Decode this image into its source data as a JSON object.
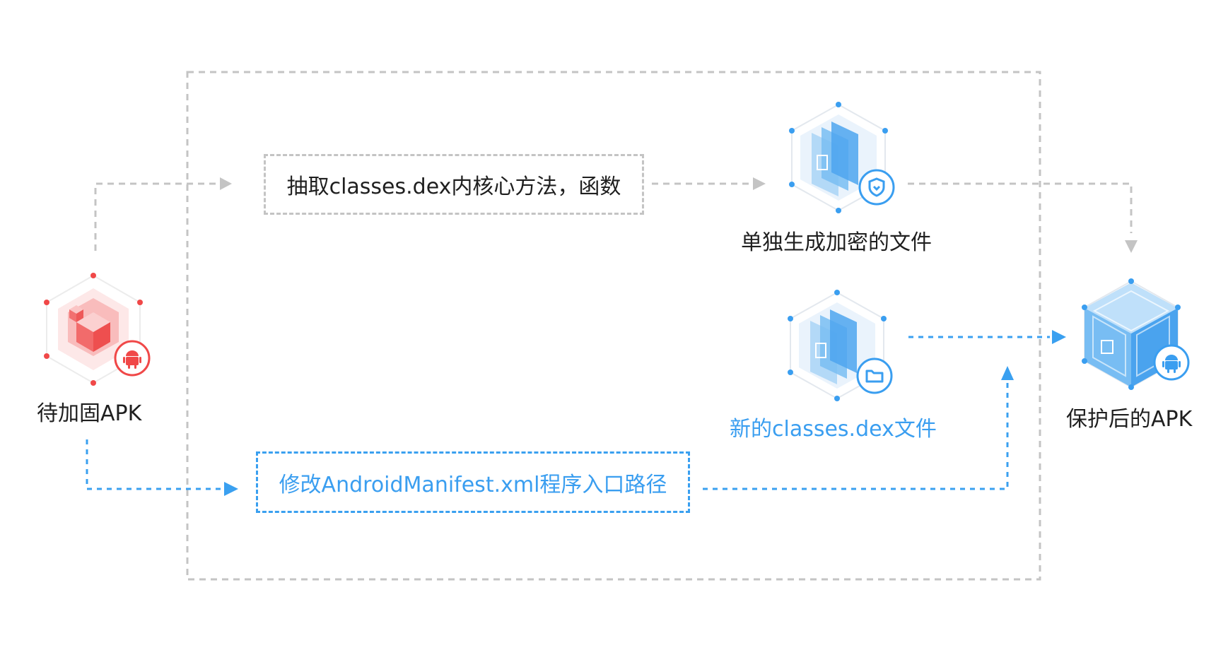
{
  "nodes": {
    "source_apk": {
      "label": "待加固APK",
      "icon": "apk-hexagon-icon",
      "badge": "android-icon"
    },
    "encrypted_file": {
      "label": "单独生成加密的文件",
      "icon": "file-stack-icon",
      "badge": "shield-icon"
    },
    "new_dex": {
      "label": "新的classes.dex文件",
      "icon": "file-stack-icon",
      "badge": "folder-icon"
    },
    "protected_apk": {
      "label": "保护后的APK",
      "icon": "cube-icon",
      "badge": "android-icon"
    }
  },
  "steps": {
    "extract": {
      "label": "抽取classes.dex内核心方法，函数"
    },
    "modify": {
      "label": "修改AndroidManifest.xml程序入口路径"
    }
  },
  "colors": {
    "gray_line": "#c4c4c4",
    "blue_line": "#3aa0f0",
    "red_accent": "#f04848",
    "blue_accent": "#3a9ef0",
    "text_dark": "#1f1f1f"
  }
}
